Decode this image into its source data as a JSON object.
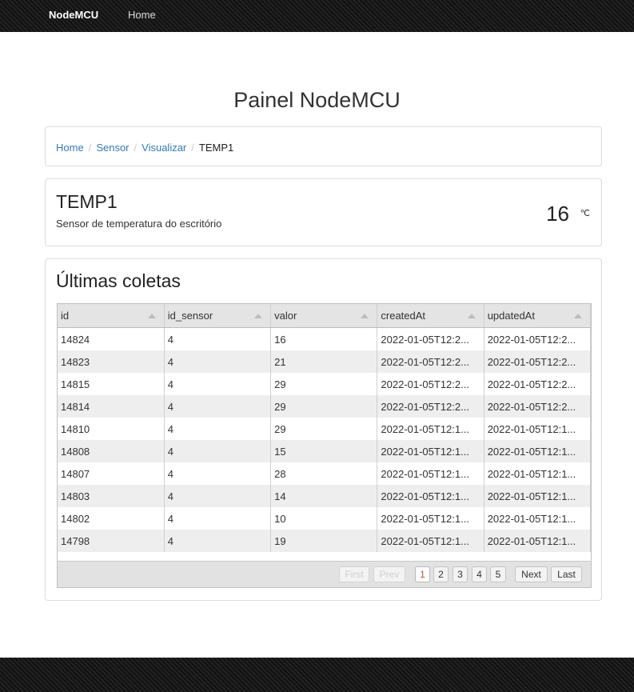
{
  "navbar": {
    "brand": "NodeMCU",
    "home": "Home"
  },
  "page_title": "Painel NodeMCU",
  "breadcrumb": [
    "Home",
    "Sensor",
    "Visualizar",
    "TEMP1"
  ],
  "sensor": {
    "name": "TEMP1",
    "description": "Sensor de temperatura do escritório",
    "value": "16",
    "unit": "℃"
  },
  "coletas": {
    "title": "Últimas coletas",
    "columns": [
      "id",
      "id_sensor",
      "valor",
      "createdAt",
      "updatedAt"
    ],
    "rows": [
      [
        "14824",
        "4",
        "16",
        "2022-01-05T12:2...",
        "2022-01-05T12:2..."
      ],
      [
        "14823",
        "4",
        "21",
        "2022-01-05T12:2...",
        "2022-01-05T12:2..."
      ],
      [
        "14815",
        "4",
        "29",
        "2022-01-05T12:2...",
        "2022-01-05T12:2..."
      ],
      [
        "14814",
        "4",
        "29",
        "2022-01-05T12:2...",
        "2022-01-05T12:2..."
      ],
      [
        "14810",
        "4",
        "29",
        "2022-01-05T12:1...",
        "2022-01-05T12:1..."
      ],
      [
        "14808",
        "4",
        "15",
        "2022-01-05T12:1...",
        "2022-01-05T12:1..."
      ],
      [
        "14807",
        "4",
        "28",
        "2022-01-05T12:1...",
        "2022-01-05T12:1..."
      ],
      [
        "14803",
        "4",
        "14",
        "2022-01-05T12:1...",
        "2022-01-05T12:1..."
      ],
      [
        "14802",
        "4",
        "10",
        "2022-01-05T12:1...",
        "2022-01-05T12:1..."
      ],
      [
        "14798",
        "4",
        "19",
        "2022-01-05T12:1...",
        "2022-01-05T12:1..."
      ]
    ],
    "pager": {
      "first": "First",
      "prev": "Prev",
      "pages": [
        "1",
        "2",
        "3",
        "4",
        "5"
      ],
      "next": "Next",
      "last": "Last",
      "current_page": "1"
    }
  },
  "colors": {
    "link": "#337ab7",
    "active_page": "#d04a3a",
    "nav_bg": "#1b1b1b"
  }
}
